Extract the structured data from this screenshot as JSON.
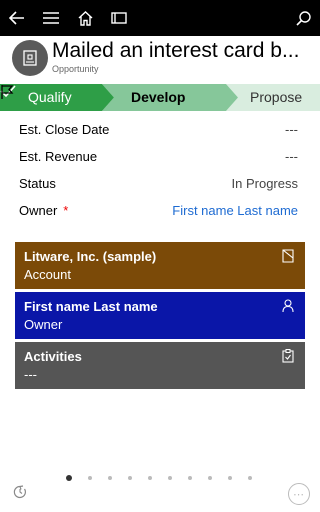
{
  "record": {
    "title": "Mailed an interest card b...",
    "entity": "Opportunity"
  },
  "process": {
    "stages": [
      {
        "label": "Qualify",
        "status": "completed"
      },
      {
        "label": "Develop",
        "status": "active"
      },
      {
        "label": "Propose",
        "status": "upcoming"
      }
    ]
  },
  "fields": [
    {
      "label": "Est. Close Date",
      "value": "---"
    },
    {
      "label": "Est. Revenue",
      "value": "---"
    },
    {
      "label": "Status",
      "value": "In Progress"
    },
    {
      "label": "Owner",
      "required_mark": "*",
      "value": "First name Last name"
    }
  ],
  "tiles": {
    "account": {
      "title": "Litware, Inc. (sample)",
      "subtitle": "Account",
      "icon": "account-icon",
      "color": "#7b4a08"
    },
    "owner": {
      "title": "First name Last name",
      "subtitle": "Owner",
      "icon": "person-icon",
      "color": "#0a16a8"
    },
    "activities": {
      "title": "Activities",
      "subtitle": "---",
      "icon": "clipboard-icon",
      "color": "#555555"
    }
  },
  "pager": {
    "total": 10,
    "active": 1
  },
  "colors": {
    "topbar": "#000000",
    "stage_completed": "#2e9e47",
    "stage_active": "#86c79a",
    "stage_upcoming": "#d9eddf",
    "link": "#1e6bd2"
  }
}
